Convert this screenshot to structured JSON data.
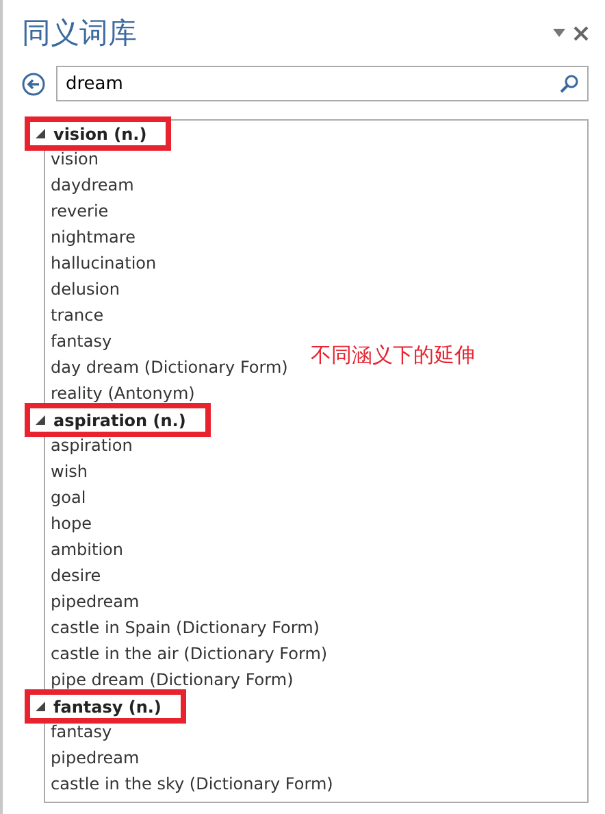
{
  "pane": {
    "title": "同义词库"
  },
  "search": {
    "value": "dream"
  },
  "groups": [
    {
      "heading": "vision (n.)",
      "expanded": true,
      "highlighted": true,
      "items": [
        "vision",
        "daydream",
        "reverie",
        "nightmare",
        "hallucination",
        "delusion",
        "trance",
        "fantasy",
        "day dream (Dictionary Form)",
        "reality (Antonym)"
      ]
    },
    {
      "heading": "aspiration (n.)",
      "expanded": true,
      "highlighted": true,
      "items": [
        "aspiration",
        "wish",
        "goal",
        "hope",
        "ambition",
        "desire",
        "pipedream",
        "castle in Spain (Dictionary Form)",
        "castle in the air (Dictionary Form)",
        "pipe dream (Dictionary Form)"
      ]
    },
    {
      "heading": "fantasy (n.)",
      "expanded": true,
      "highlighted": true,
      "items": [
        "fantasy",
        "pipedream",
        "castle in the sky (Dictionary Form)"
      ]
    }
  ],
  "annotation": "不同涵义下的延伸"
}
